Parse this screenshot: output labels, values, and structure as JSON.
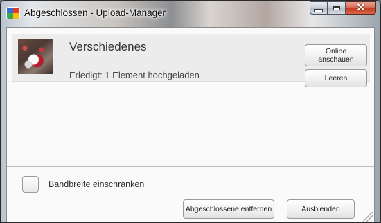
{
  "window": {
    "title": "Abgeschlossen - Upload-Manager"
  },
  "caption_buttons": {
    "minimize_icon": "minimize-icon",
    "maximize_icon": "maximize-icon",
    "close_icon": "close-icon",
    "close_glyph": "✕"
  },
  "upload_item": {
    "title": "Verschiedenes",
    "status": "Erledigt: 1 Element hochgeladen",
    "online_button_label": "Online\nanschauen",
    "clear_button_label": "Leeren"
  },
  "footer": {
    "bandwidth_label": "Bandbreite einschränken",
    "bandwidth_checked": false,
    "remove_completed_label": "Abgeschlossene entfernen",
    "hide_label": "Ausblenden"
  },
  "colors": {
    "close_button": "#c33a1f",
    "client_background": "#fafafa",
    "item_background": "#ececec"
  }
}
